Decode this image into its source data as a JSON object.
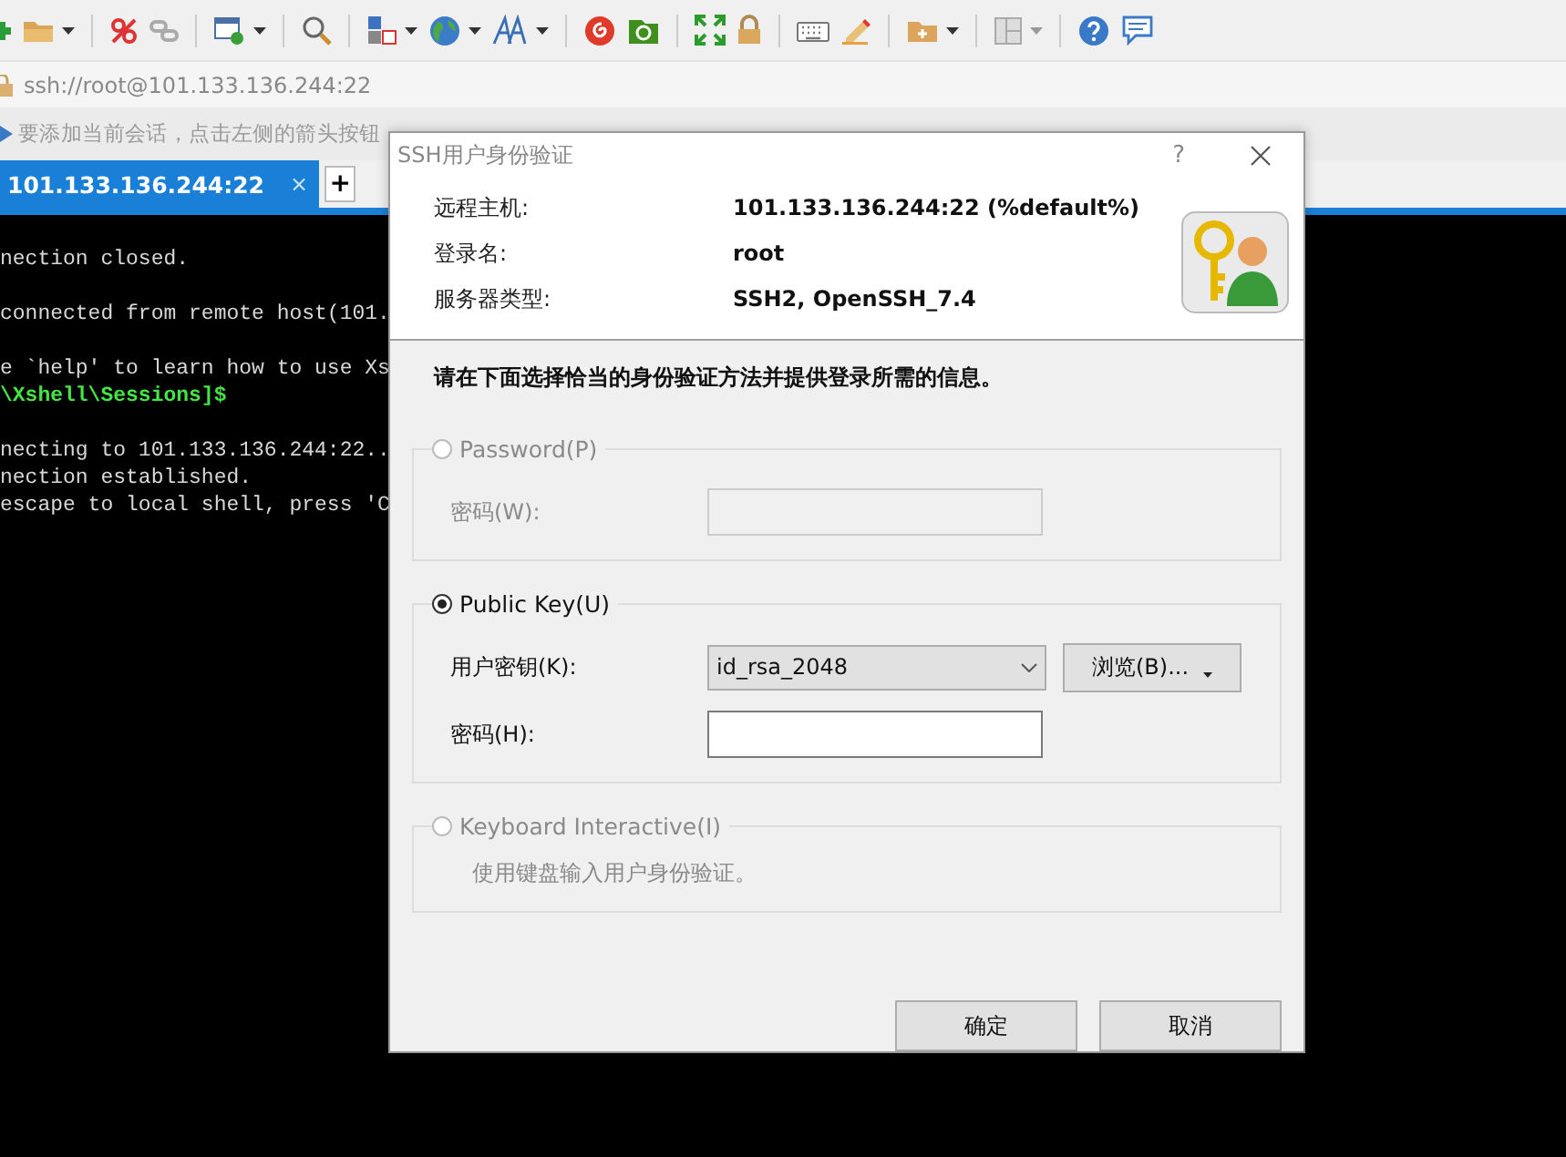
{
  "address_bar": {
    "value": "ssh://root@101.133.136.244:22"
  },
  "info_bar": {
    "text": "要添加当前会话，点击左侧的箭头按钮"
  },
  "tabs": [
    {
      "label": "101.133.136.244:22",
      "selected": true,
      "close": "×"
    }
  ],
  "new_tab": "+",
  "terminal": {
    "lines": [
      {
        "kind": "output",
        "text": "nection closed."
      },
      {
        "kind": "blank"
      },
      {
        "kind": "output",
        "text": "connected from remote host(101."
      },
      {
        "kind": "blank"
      },
      {
        "kind": "output",
        "text": "e `help' to learn how to use Xs"
      },
      {
        "kind": "prompt",
        "text": "\\Xshell\\Sessions]$"
      },
      {
        "kind": "blank"
      },
      {
        "kind": "output",
        "text": "necting to 101.133.136.244:22.."
      },
      {
        "kind": "output",
        "text": "nection established."
      },
      {
        "kind": "output",
        "text": "escape to local shell, press 'C"
      }
    ]
  },
  "dialog": {
    "title": "SSH用户身份验证",
    "help": "?",
    "info": [
      {
        "label": "远程主机:",
        "value": "101.133.136.244:22 (%default%)"
      },
      {
        "label": "登录名:",
        "value": "root"
      },
      {
        "label": "服务器类型:",
        "value": "SSH2, OpenSSH_7.4"
      }
    ],
    "instruction": "请在下面选择恰当的身份验证方法并提供登录所需的信息。",
    "methods": [
      {
        "kind": "password",
        "label": "Password(P)",
        "selected": false,
        "disabled": true,
        "field_label": "密码(W):"
      },
      {
        "kind": "public_key",
        "label": "Public Key(U)",
        "selected": true,
        "disabled": false,
        "key_label": "用户密钥(K):",
        "key_value": "id_rsa_2048",
        "browse": "浏览(B)...",
        "field_label": "密码(H):"
      },
      {
        "kind": "keyboard",
        "label": "Keyboard Interactive(I)",
        "selected": false,
        "disabled": true,
        "description": "使用键盘输入用户身份验证。"
      }
    ],
    "buttons": [
      "确定",
      "取消"
    ]
  }
}
